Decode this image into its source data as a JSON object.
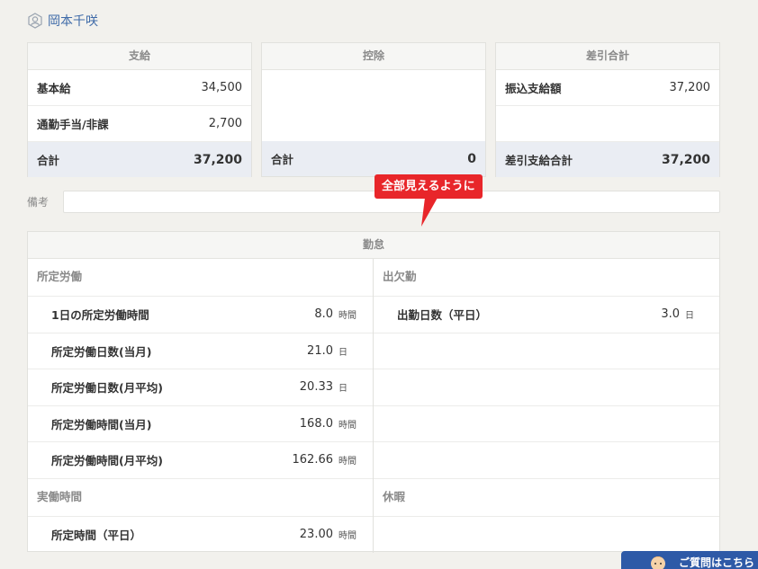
{
  "employee": {
    "name": "岡本千咲"
  },
  "payments": {
    "title": "支給",
    "rows": [
      {
        "label": "基本給",
        "value": "34,500"
      },
      {
        "label": "通勤手当/非課",
        "value": "2,700"
      }
    ],
    "total_label": "合計",
    "total_value": "37,200"
  },
  "deductions": {
    "title": "控除",
    "total_label": "合計",
    "total_value": "0"
  },
  "net": {
    "title": "差引合計",
    "rows": [
      {
        "label": "振込支給額",
        "value": "37,200"
      }
    ],
    "total_label": "差引支給合計",
    "total_value": "37,200"
  },
  "remarks": {
    "label": "備考",
    "value": ""
  },
  "tooltip": {
    "text": "全部見えるように"
  },
  "attendance": {
    "title": "勤怠",
    "scheduled": {
      "title": "所定労働",
      "rows": [
        {
          "label": "1日の所定労働時間",
          "value": "8.0",
          "unit": "時間"
        },
        {
          "label": "所定労働日数(当月)",
          "value": "21.0",
          "unit": "日"
        },
        {
          "label": "所定労働日数(月平均)",
          "value": "20.33",
          "unit": "日"
        },
        {
          "label": "所定労働時間(当月)",
          "value": "168.0",
          "unit": "時間"
        },
        {
          "label": "所定労働時間(月平均)",
          "value": "162.66",
          "unit": "時間"
        }
      ]
    },
    "actual": {
      "title": "実働時間",
      "rows": [
        {
          "label": "所定時間（平日）",
          "value": "23.00",
          "unit": "時間"
        }
      ]
    },
    "presence": {
      "title": "出欠勤",
      "rows": [
        {
          "label": "出勤日数（平日）",
          "value": "3.0",
          "unit": "日"
        }
      ]
    },
    "leave": {
      "title": "休暇"
    }
  },
  "help": {
    "label": "ご質問はこちら"
  },
  "colors": {
    "accent": "#3e6aa8",
    "tooltip": "#e8262a",
    "total_bg": "#eaedf3",
    "help_bg": "#2e5aa7"
  }
}
